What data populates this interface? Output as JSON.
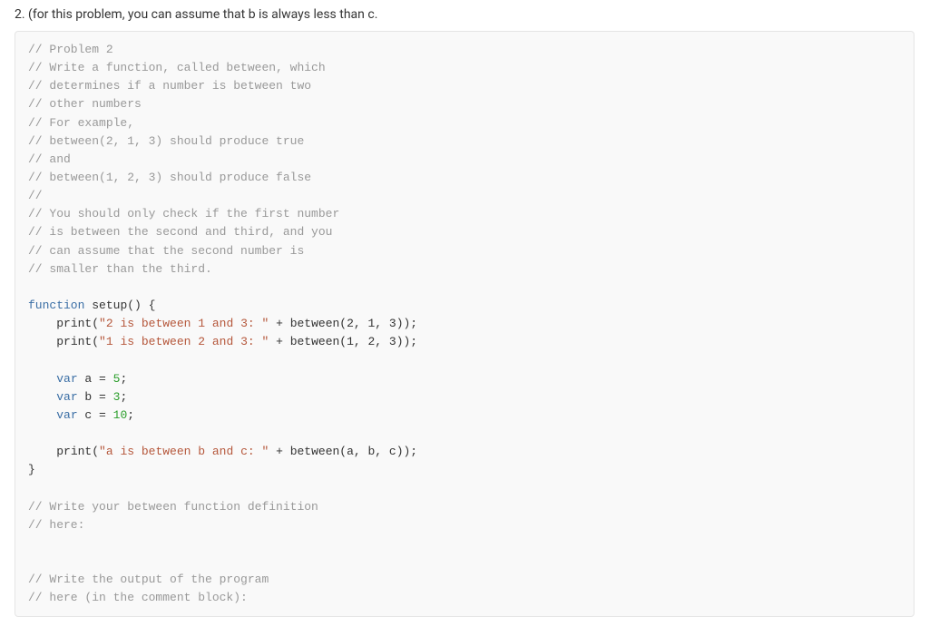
{
  "question": {
    "prompt": "2. (for this problem, you can assume that b is always less than c."
  },
  "code": {
    "c1": "// Problem 2",
    "c2": "// Write a function, called between, which",
    "c3": "// determines if a number is between two",
    "c4": "// other numbers",
    "c5": "// For example,",
    "c6": "// between(2, 1, 3) should produce true",
    "c7": "// and",
    "c8": "// between(1, 2, 3) should produce false",
    "c9": "//",
    "c10": "// You should only check if the first number",
    "c11": "// is between the second and third, and you",
    "c12": "// can assume that the second number is",
    "c13": "// smaller than the third.",
    "kw_function": "function",
    "fn_setup": "setup",
    "paren_empty": "()",
    "brace_open": " {",
    "brace_close": "}",
    "print": "print",
    "str_p1": "\"2 is between 1 and 3: \"",
    "str_p2": "\"1 is between 2 and 3: \"",
    "str_p3": "\"a is between b and c: \"",
    "between": "between",
    "call_b1": "(2, 1, 3));",
    "call_b2": "(1, 2, 3));",
    "call_b3": "(a, b, c));",
    "kw_var": "var",
    "var_a": " a = ",
    "var_b": " b = ",
    "var_c": " c = ",
    "n5": "5",
    "n3": "3",
    "n10": "10",
    "semi": ";",
    "plus": " + ",
    "lparen": "(",
    "c14": "// Write your between function definition",
    "c15": "// here:",
    "c16": "// Write the output of the program",
    "c17": "// here (in the comment block):"
  }
}
